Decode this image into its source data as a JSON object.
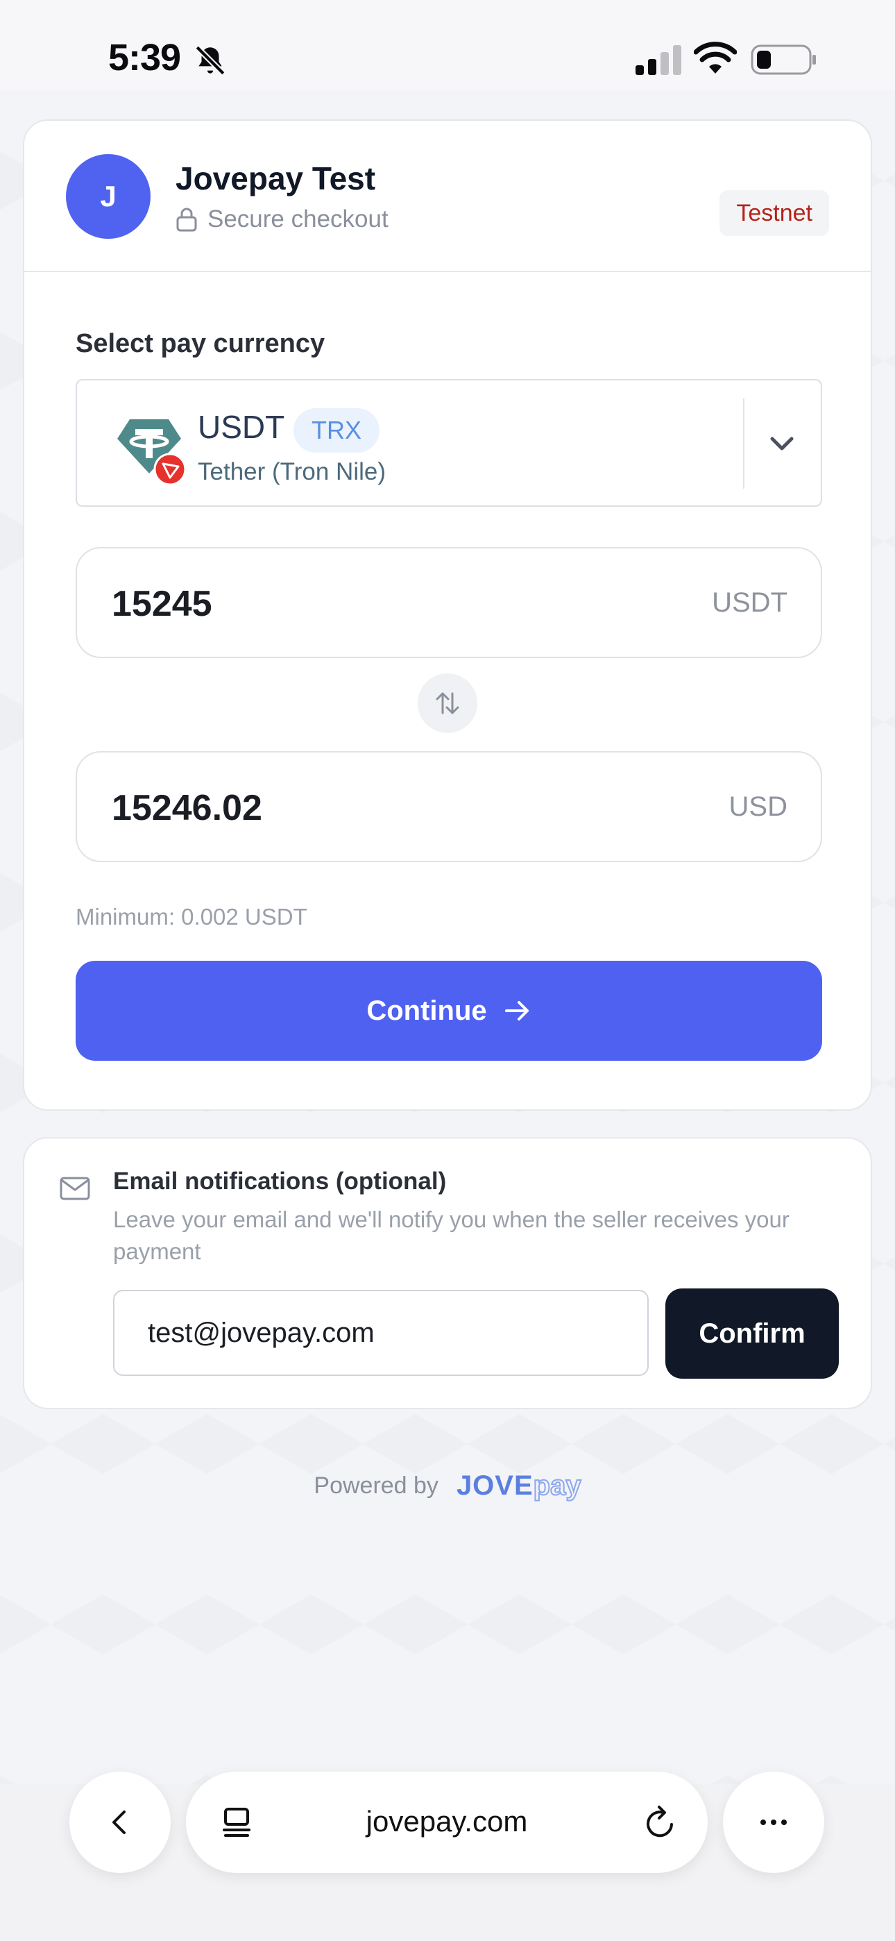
{
  "status_bar": {
    "time": "5:39"
  },
  "merchant": {
    "initial": "J",
    "name": "Jovepay Test",
    "secure_label": "Secure checkout",
    "badge": "Testnet"
  },
  "currency": {
    "section_label": "Select pay currency",
    "code": "USDT",
    "network": "TRX",
    "name": "Tether (Tron Nile)"
  },
  "amounts": {
    "crypto_value": "15245",
    "crypto_unit": "USDT",
    "fiat_value": "15246.02",
    "fiat_unit": "USD",
    "minimum": "Minimum: 0.002 USDT"
  },
  "continue_label": "Continue",
  "email": {
    "title": "Email notifications (optional)",
    "description": "Leave your email and we'll notify you when the seller receives your payment",
    "value": "test@jovepay.com",
    "confirm_label": "Confirm"
  },
  "footer": {
    "powered_by": "Powered by",
    "brand_primary": "JOVE",
    "brand_secondary": "pay"
  },
  "browser": {
    "url": "jovepay.com"
  },
  "colors": {
    "accent": "#4f61f0",
    "testnet": "#b42318",
    "tron_red": "#e5322d",
    "tether_teal": "#4f8a8b",
    "dark_button": "#111827"
  }
}
